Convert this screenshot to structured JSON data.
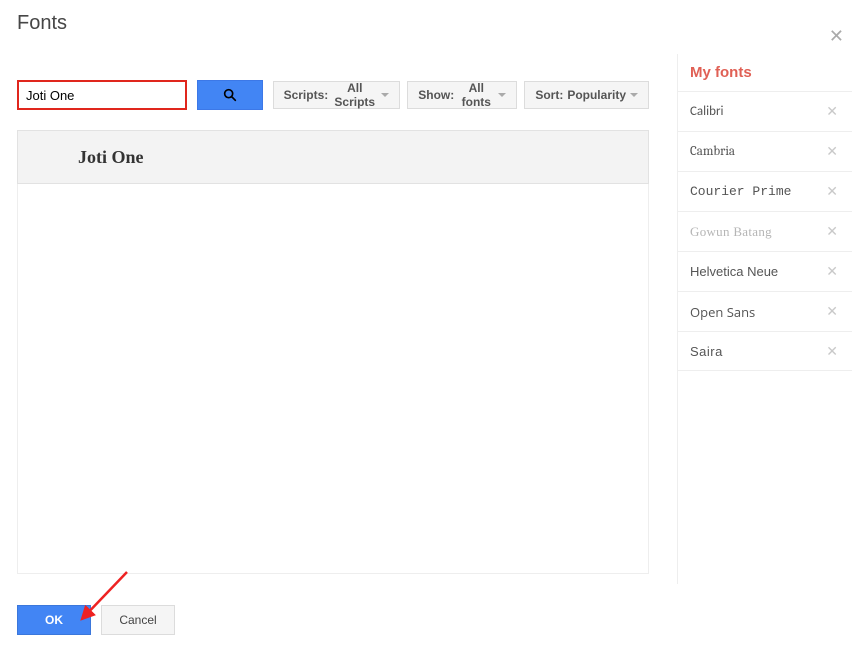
{
  "dialog": {
    "title": "Fonts"
  },
  "search": {
    "value": "Joti One"
  },
  "filters": {
    "scripts_prefix": "Scripts: ",
    "scripts_value": "All Scripts",
    "show_prefix": "Show: ",
    "show_value": "All fonts",
    "sort_prefix": "Sort: ",
    "sort_value": "Popularity"
  },
  "result": {
    "family": "Joti One"
  },
  "myfonts": {
    "heading": "My fonts",
    "items": [
      {
        "name": "Calibri",
        "cls": "f-calibri",
        "active": true
      },
      {
        "name": "Cambria",
        "cls": "f-cambria",
        "active": true
      },
      {
        "name": "Courier Prime",
        "cls": "f-courier",
        "active": true
      },
      {
        "name": "Gowun Batang",
        "cls": "f-gowun",
        "active": false
      },
      {
        "name": "Helvetica Neue",
        "cls": "f-helv",
        "active": true
      },
      {
        "name": "Open Sans",
        "cls": "f-open",
        "active": true
      },
      {
        "name": "Saira",
        "cls": "f-saira",
        "active": true
      }
    ]
  },
  "footer": {
    "ok": "OK",
    "cancel": "Cancel"
  }
}
